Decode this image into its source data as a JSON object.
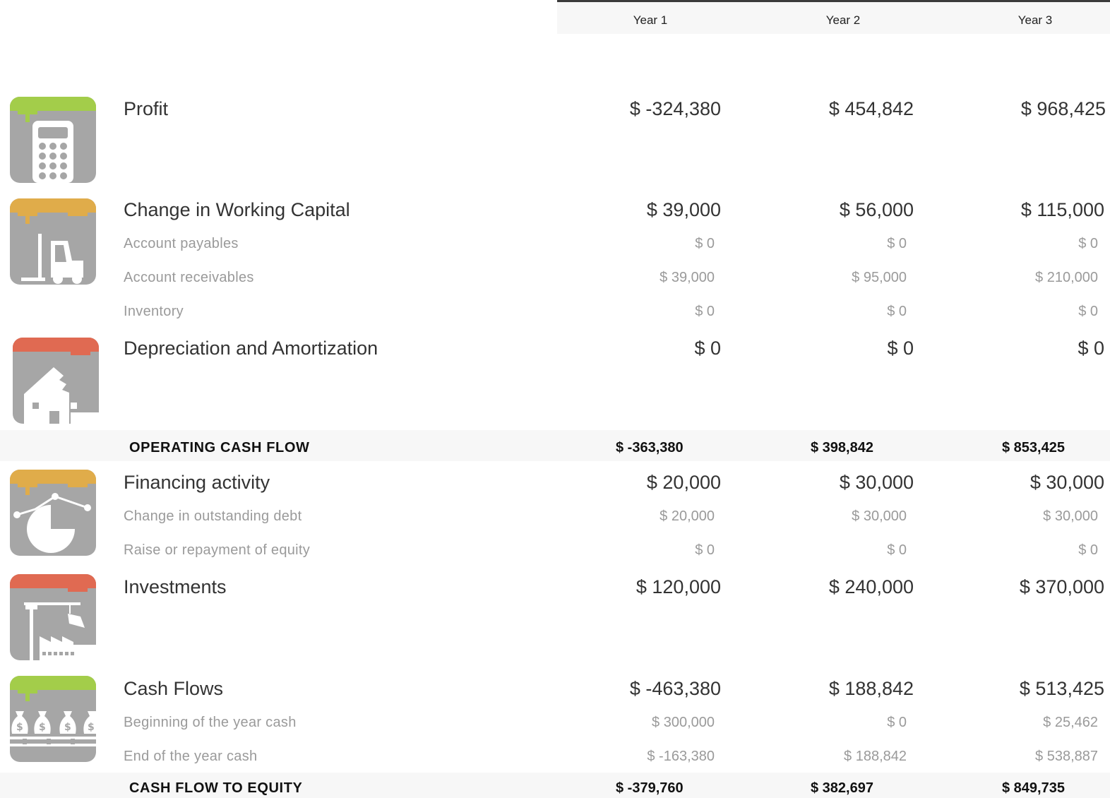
{
  "header": {
    "years": [
      "Year 1",
      "Year 2",
      "Year 3"
    ]
  },
  "colors": {
    "icon_gray": "#a6a6a6",
    "green": "#a3cd4a",
    "orange": "#e0ac4a",
    "red": "#e06a52",
    "header_border": "#3b3b3b",
    "row_bg": "#f7f7f7"
  },
  "profit": {
    "icon": "calculator-icon",
    "label": "Profit",
    "values": [
      "$ -324,380",
      "$ 454,842",
      "$ 968,425"
    ]
  },
  "working_capital": {
    "icon": "forklift-icon",
    "label": "Change in Working Capital",
    "values": [
      "$ 39,000",
      "$ 56,000",
      "$ 115,000"
    ],
    "rows": [
      {
        "label": "Account payables",
        "values": [
          "$ 0",
          "$ 0",
          "$ 0"
        ]
      },
      {
        "label": "Account receivables",
        "values": [
          "$ 39,000",
          "$ 95,000",
          "$ 210,000"
        ]
      },
      {
        "label": "Inventory",
        "values": [
          "$ 0",
          "$ 0",
          "$ 0"
        ]
      }
    ]
  },
  "depreciation": {
    "icon": "broken-house-icon",
    "label": "Depreciation and Amortization",
    "values": [
      "$ 0",
      "$ 0",
      "$ 0"
    ]
  },
  "operating_cash_flow": {
    "label": "OPERATING CASH FLOW",
    "values": [
      "$ -363,380",
      "$ 398,842",
      "$ 853,425"
    ]
  },
  "financing": {
    "icon": "pie-chart-icon",
    "label": "Financing activity",
    "values": [
      "$ 20,000",
      "$ 30,000",
      "$ 30,000"
    ],
    "rows": [
      {
        "label": "Change in outstanding debt",
        "values": [
          "$ 20,000",
          "$ 30,000",
          "$ 30,000"
        ]
      },
      {
        "label": "Raise or repayment of equity",
        "values": [
          "$ 0",
          "$ 0",
          "$ 0"
        ]
      }
    ]
  },
  "investments": {
    "icon": "factory-crane-icon",
    "label": "Investments",
    "values": [
      "$ 120,000",
      "$ 240,000",
      "$ 370,000"
    ]
  },
  "cash_flows": {
    "icon": "money-bags-icon",
    "label": "Cash Flows",
    "values": [
      "$ -463,380",
      "$ 188,842",
      "$ 513,425"
    ],
    "rows": [
      {
        "label": "Beginning of the year cash",
        "values": [
          "$ 300,000",
          "$ 0",
          "$ 25,462"
        ]
      },
      {
        "label": "End of the year cash",
        "values": [
          "$ -163,380",
          "$ 188,842",
          "$ 538,887"
        ]
      }
    ]
  },
  "cash_flow_to_equity": {
    "label": "CASH FLOW TO EQUITY",
    "values": [
      "$ -379,760",
      "$ 382,697",
      "$ 849,735"
    ]
  }
}
